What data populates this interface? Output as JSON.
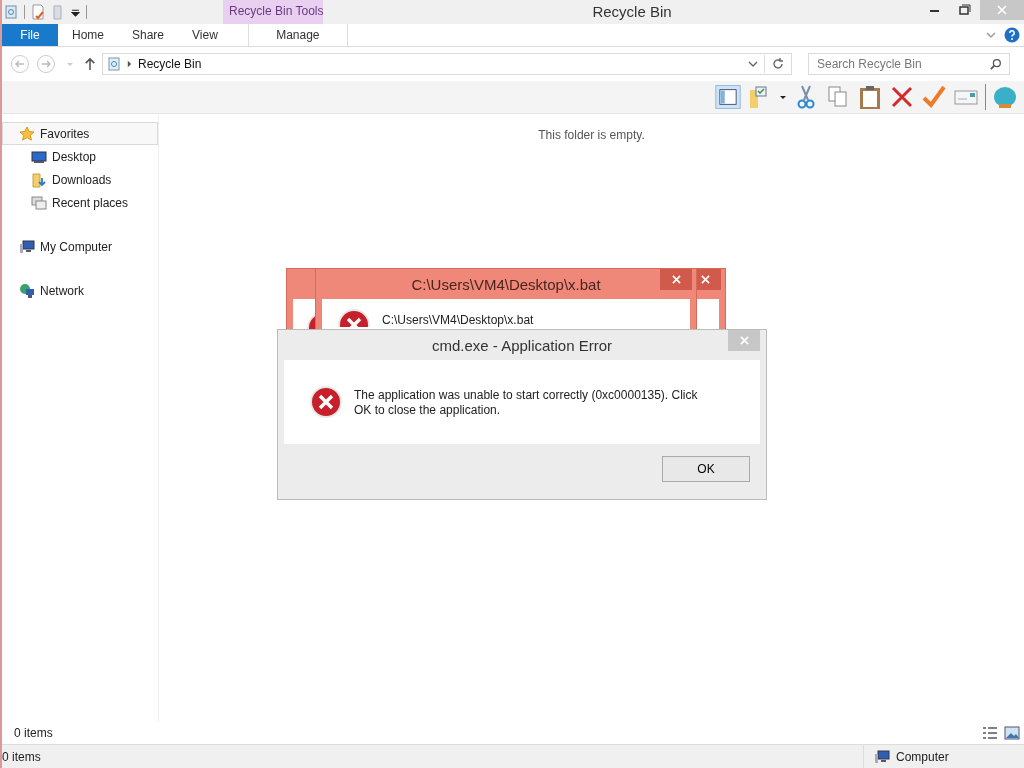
{
  "window": {
    "title": "Recycle Bin",
    "context_tab": "Recycle Bin Tools"
  },
  "ribbon_tabs": [
    {
      "label": "File",
      "kind": "file"
    },
    {
      "label": "Home",
      "kind": "plain"
    },
    {
      "label": "Share",
      "kind": "plain"
    },
    {
      "label": "View",
      "kind": "plain"
    },
    {
      "label": "Manage",
      "kind": "context"
    }
  ],
  "address": {
    "path": "Recycle Bin"
  },
  "search": {
    "placeholder": "Search Recycle Bin"
  },
  "navigation": [
    {
      "label": "Favorites",
      "kind": "star",
      "selected": true,
      "children": [
        {
          "label": "Desktop",
          "kind": "desktop",
          "selected": false
        },
        {
          "label": "Downloads",
          "kind": "downloads",
          "selected": false
        },
        {
          "label": "Recent places",
          "kind": "recent",
          "selected": false
        }
      ]
    },
    {
      "label": "My Computer",
      "kind": "computer",
      "selected": false
    },
    {
      "label": "Network",
      "kind": "network",
      "selected": false
    }
  ],
  "content": {
    "empty_message": "This folder is empty."
  },
  "status_bar": {
    "items": "0 items"
  },
  "bottom_bar": {
    "items": "0 items",
    "location": "Computer"
  },
  "dialogs": [
    {
      "kind": "red_back"
    },
    {
      "kind": "red",
      "title": "C:\\Users\\VM4\\Desktop\\x.bat",
      "message": "C:\\Users\\VM4\\Desktop\\x.bat"
    },
    {
      "kind": "plain",
      "title": "cmd.exe - Application Error",
      "message": "The application was unable to start correctly (0xc0000135). Click OK to close the application.",
      "buttons": [
        "OK"
      ]
    }
  ]
}
